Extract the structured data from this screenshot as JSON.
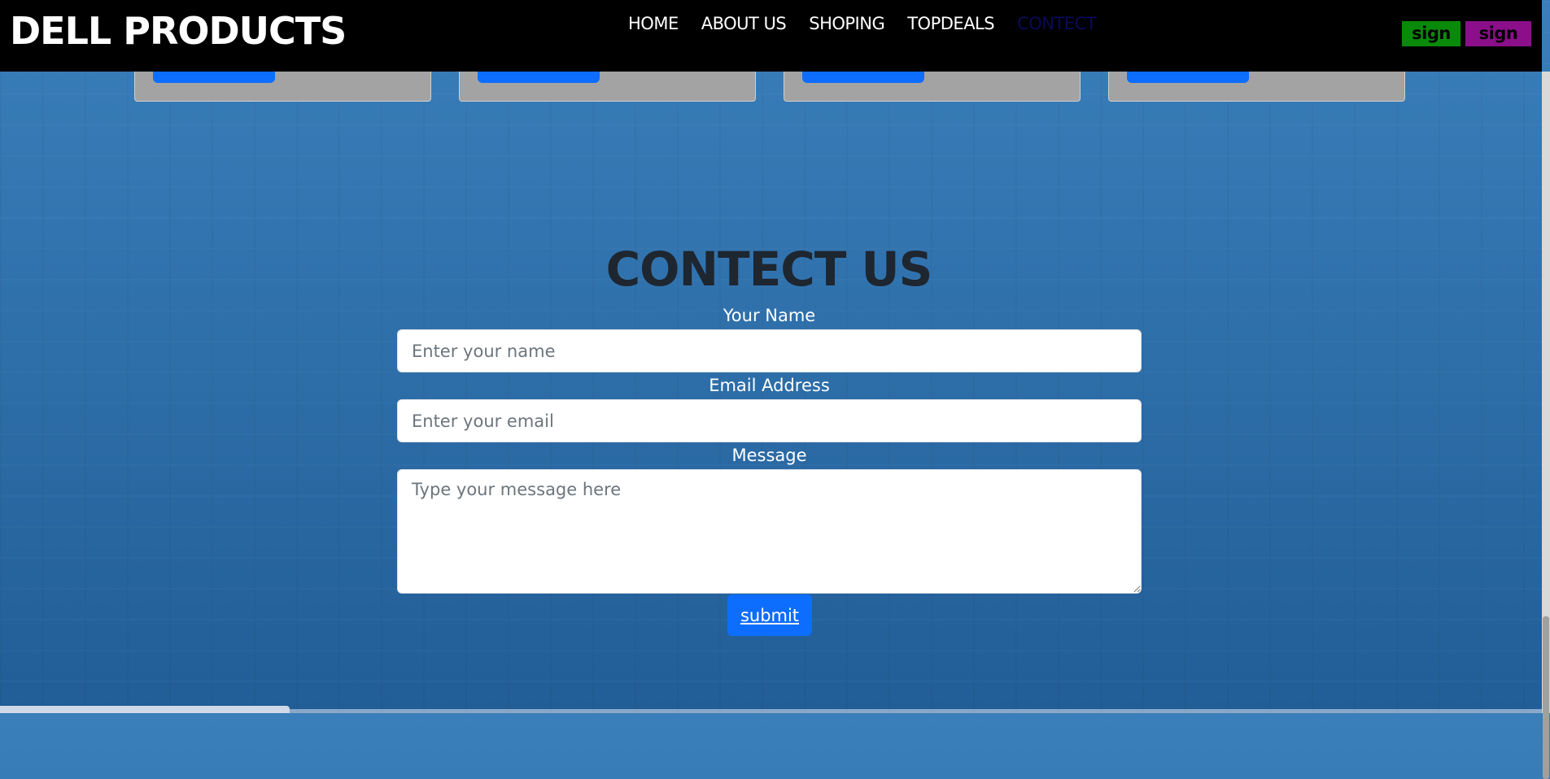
{
  "navbar": {
    "brand": "DELL PRODUCTS",
    "links": [
      {
        "label": "HOME",
        "active": false
      },
      {
        "label": "ABOUT US",
        "active": false
      },
      {
        "label": "SHOPING",
        "active": false
      },
      {
        "label": "TOPDEALS",
        "active": false
      },
      {
        "label": "CONTECT",
        "active": true
      }
    ],
    "sign_in": "sign In",
    "sign_up": "sign Up"
  },
  "contact": {
    "title": "CONTECT US",
    "name_label": "Your Name",
    "name_placeholder": "Enter your name",
    "email_label": "Email Address",
    "email_placeholder": "Enter your email",
    "message_label": "Message",
    "message_placeholder": "Type your message here",
    "submit": "submit"
  },
  "colors": {
    "navbar_bg": "#000000",
    "sign_in_bg": "#0a8a0a",
    "sign_up_bg": "#8b0f8b",
    "primary": "#0d6efd",
    "page_bg": "#2f70ab"
  }
}
